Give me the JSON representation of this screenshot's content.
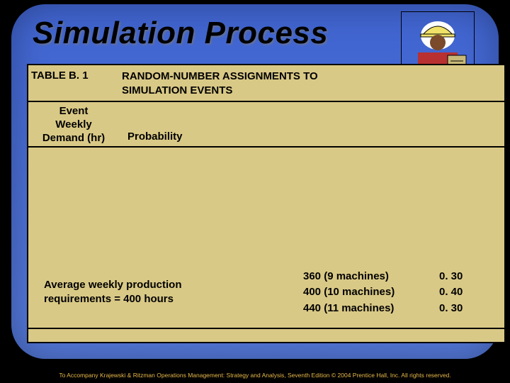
{
  "title": "Simulation Process",
  "table_label": "TABLE B. 1",
  "table_title": "RANDOM-NUMBER ASSIGNMENTS TO SIMULATION EVENTS",
  "col1_header": "Event\nWeekly\nDemand (hr)",
  "col2_header": "Probability",
  "avg_note": "Average weekly production requirements = 400 hours",
  "scenarios": [
    {
      "desc": "360 (9 machines)",
      "prob": "0. 30"
    },
    {
      "desc": "400 (10 machines)",
      "prob": "0. 40"
    },
    {
      "desc": "440 (11 machines)",
      "prob": "0. 30"
    }
  ],
  "footer": "To Accompany Krajewski & Ritzman Operations Management: Strategy and Analysis, Seventh Edition © 2004 Prentice Hall, Inc. All rights reserved.",
  "chart_data": {
    "type": "table",
    "title": "RANDOM-NUMBER ASSIGNMENTS TO SIMULATION EVENTS",
    "columns": [
      "Event Weekly Demand (hr)",
      "Probability"
    ],
    "rows": [],
    "additional_scenarios": [
      {
        "capacity_hr": 360,
        "machines": 9,
        "probability": 0.3
      },
      {
        "capacity_hr": 400,
        "machines": 10,
        "probability": 0.4
      },
      {
        "capacity_hr": 440,
        "machines": 11,
        "probability": 0.3
      }
    ],
    "average_weekly_production_hours": 400
  }
}
